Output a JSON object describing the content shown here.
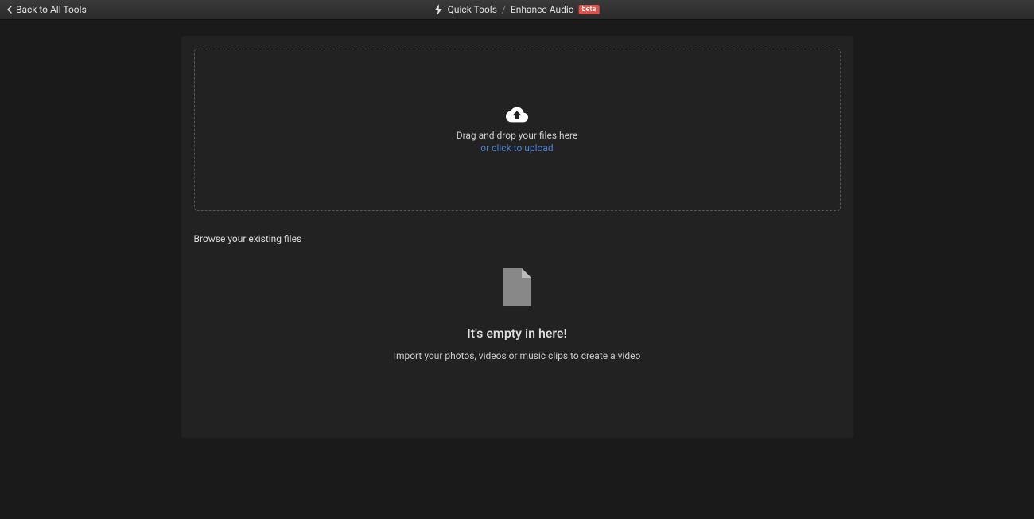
{
  "header": {
    "back_label": "Back to All Tools",
    "breadcrumb": {
      "item1": "Quick Tools",
      "separator": "/",
      "item2": "Enhance Audio",
      "badge": "beta"
    }
  },
  "dropzone": {
    "line1": "Drag and drop your files here",
    "line2": "or click to upload"
  },
  "browse": {
    "label": "Browse your existing files"
  },
  "empty": {
    "title": "It's empty in here!",
    "subtitle": "Import your photos, videos or music clips to create a video"
  }
}
